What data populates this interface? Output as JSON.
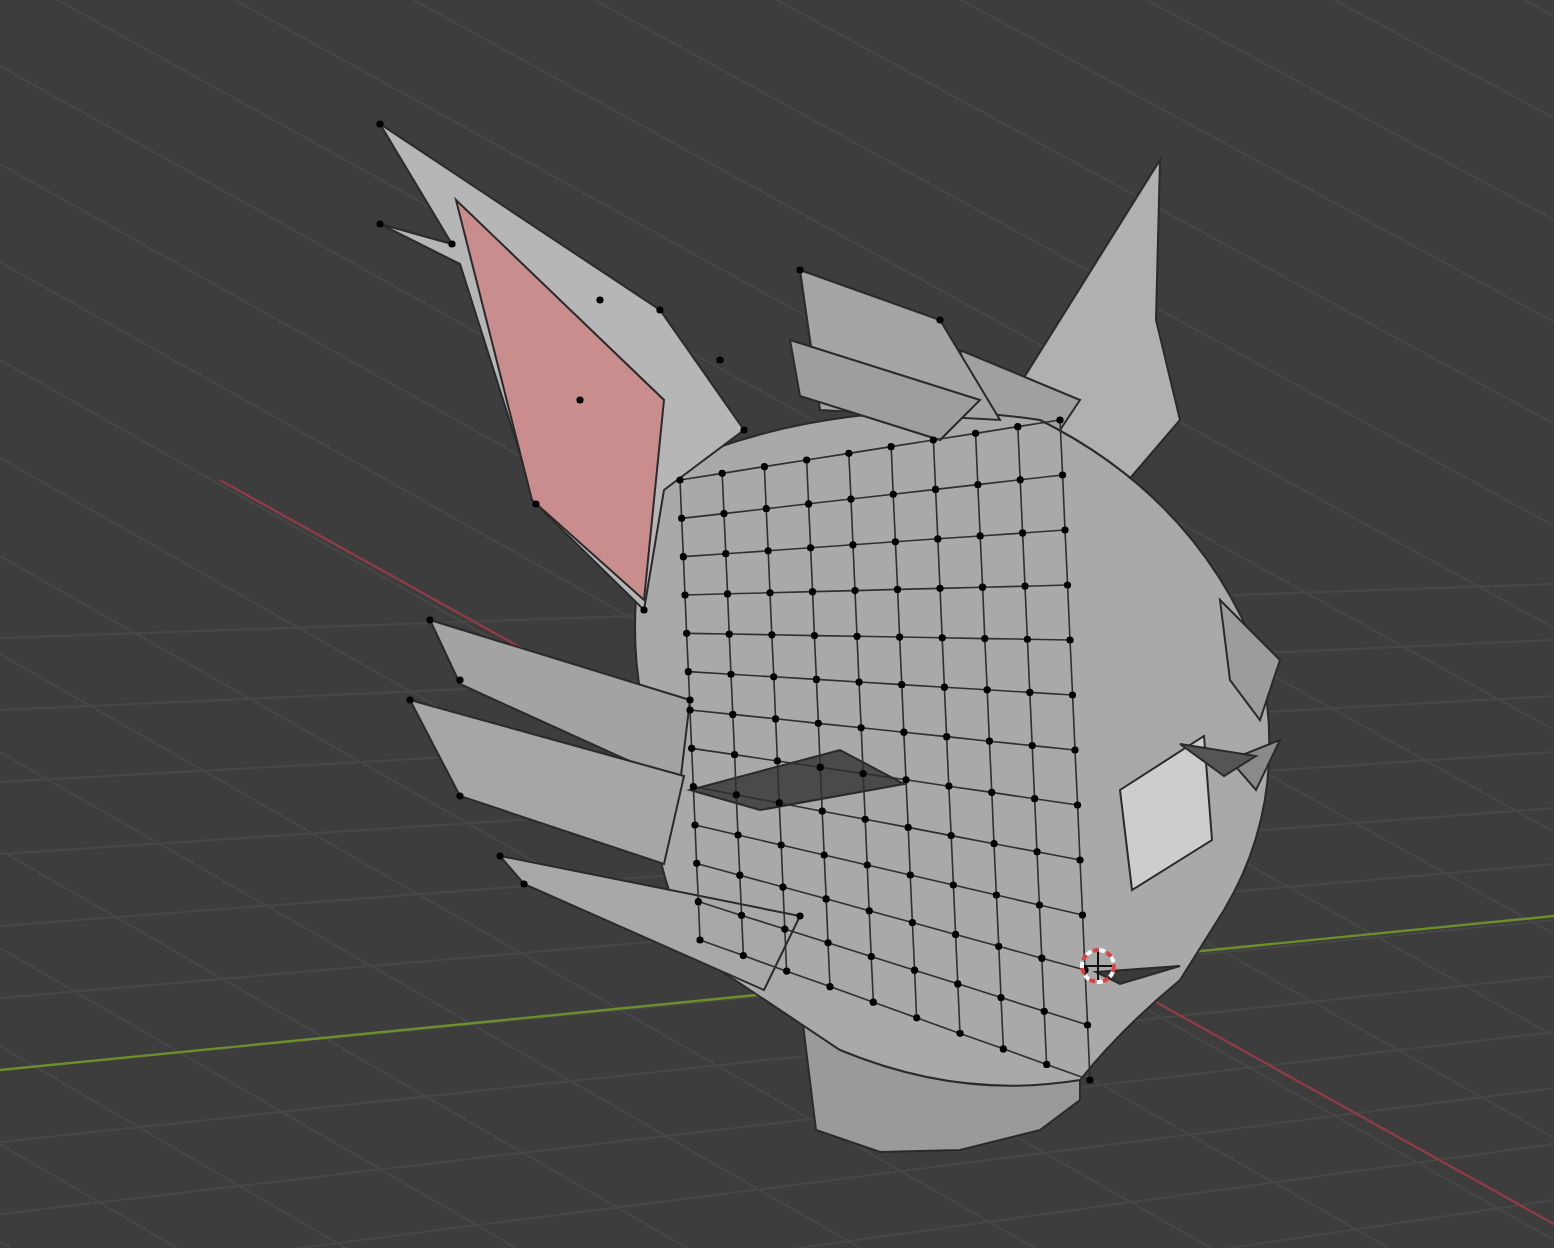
{
  "viewport": {
    "axes": [
      {
        "kind": "x",
        "color": "#8e3c46"
      },
      {
        "kind": "y",
        "color": "#6c8f2c"
      }
    ],
    "cursor_visible": true
  }
}
